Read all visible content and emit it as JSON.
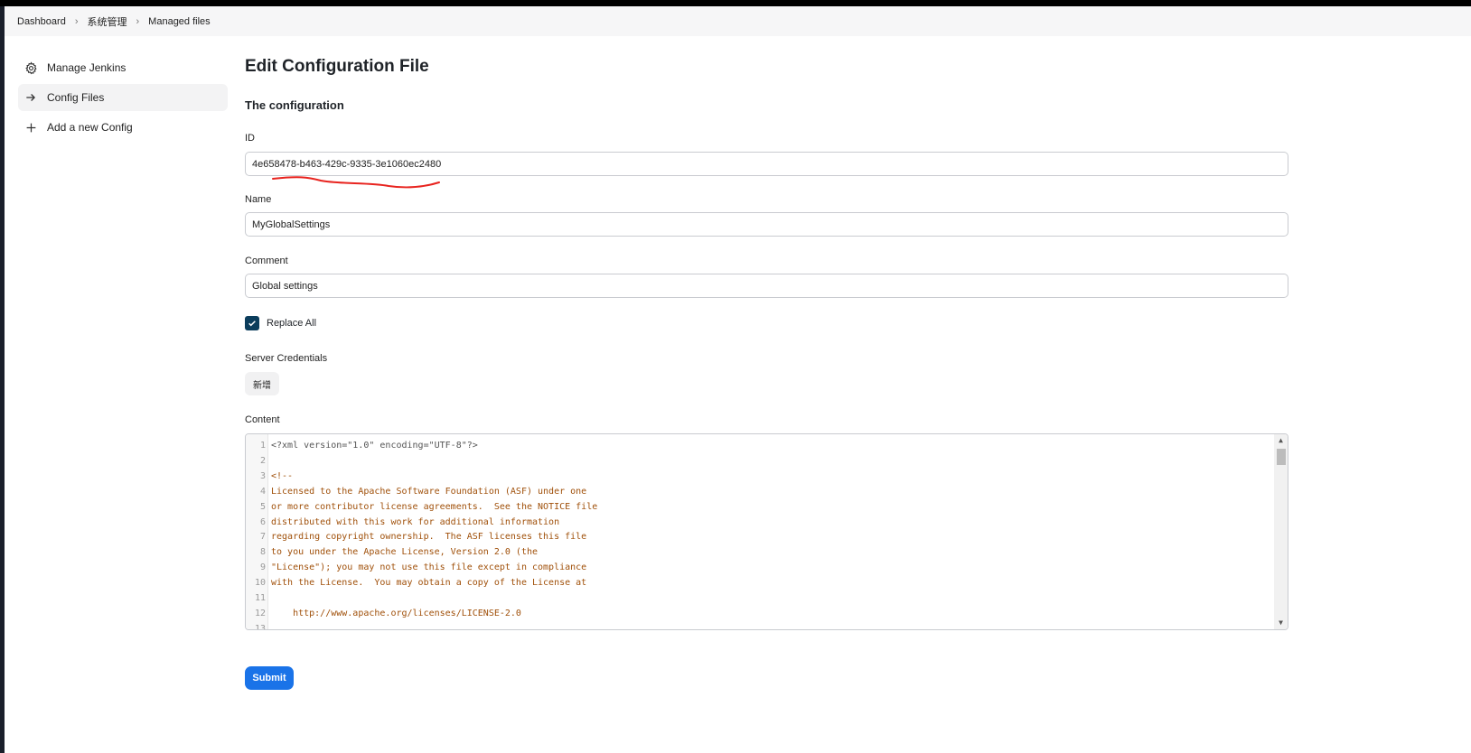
{
  "breadcrumb": [
    "Dashboard",
    "系统管理",
    "Managed files"
  ],
  "sidebar": {
    "items": [
      {
        "label": "Manage Jenkins",
        "icon": "gear-icon",
        "active": false
      },
      {
        "label": "Config Files",
        "icon": "arrow-right-icon",
        "active": true
      },
      {
        "label": "Add a new Config",
        "icon": "plus-icon",
        "active": false
      }
    ]
  },
  "page": {
    "title": "Edit Configuration File",
    "section_title": "The configuration"
  },
  "form": {
    "id_label": "ID",
    "id_value": "4e658478-b463-429c-9335-3e1060ec2480",
    "name_label": "Name",
    "name_value": "MyGlobalSettings",
    "comment_label": "Comment",
    "comment_value": "Global settings",
    "replace_all_label": "Replace All",
    "replace_all_checked": true,
    "server_credentials_label": "Server Credentials",
    "add_button_label": "新增",
    "content_label": "Content",
    "submit_label": "Submit"
  },
  "editor": {
    "lines": [
      {
        "n": "1",
        "text": "<?xml version=\"1.0\" encoding=\"UTF-8\"?>",
        "kind": "meta"
      },
      {
        "n": "2",
        "text": "",
        "kind": "meta"
      },
      {
        "n": "3",
        "text": "<!--",
        "kind": "comment"
      },
      {
        "n": "4",
        "text": "Licensed to the Apache Software Foundation (ASF) under one",
        "kind": "comment"
      },
      {
        "n": "5",
        "text": "or more contributor license agreements.  See the NOTICE file",
        "kind": "comment"
      },
      {
        "n": "6",
        "text": "distributed with this work for additional information",
        "kind": "comment"
      },
      {
        "n": "7",
        "text": "regarding copyright ownership.  The ASF licenses this file",
        "kind": "comment"
      },
      {
        "n": "8",
        "text": "to you under the Apache License, Version 2.0 (the",
        "kind": "comment"
      },
      {
        "n": "9",
        "text": "\"License\"); you may not use this file except in compliance",
        "kind": "comment"
      },
      {
        "n": "10",
        "text": "with the License.  You may obtain a copy of the License at",
        "kind": "comment"
      },
      {
        "n": "11",
        "text": "",
        "kind": "comment"
      },
      {
        "n": "12",
        "text": "    http://www.apache.org/licenses/LICENSE-2.0",
        "kind": "comment"
      },
      {
        "n": "13",
        "text": "",
        "kind": "comment"
      }
    ]
  },
  "colors": {
    "accent": "#1a73e8",
    "checkbox": "#0b3d5c",
    "comment_text": "#a0500a",
    "annotation": "#e8241f"
  }
}
